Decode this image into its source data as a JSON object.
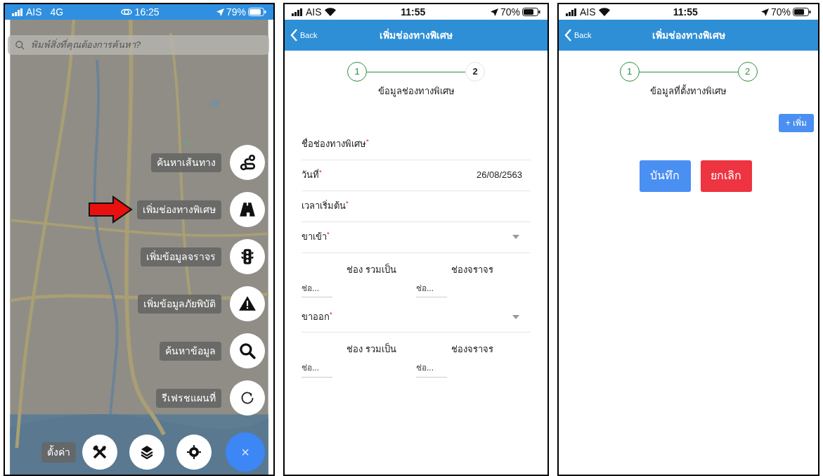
{
  "screens": [
    {
      "kind": "map",
      "status_bar": {
        "carrier": "AIS",
        "network": "4G",
        "wifi": false,
        "time": "16:25",
        "sync": true,
        "battery": "79%"
      },
      "search": {
        "placeholder": "พิมพ์สิ่งที่คุณต้องการค้นหา?"
      },
      "menu": [
        {
          "label": "ค้นหาเส้นทาง",
          "kind": "route",
          "pointed": false
        },
        {
          "label": "เพิ่มช่องทางพิเศษ",
          "kind": "road",
          "pointed": true
        },
        {
          "label": "เพิ่มข้อมูลจราจร",
          "kind": "traffic",
          "pointed": false
        },
        {
          "label": "เพิ่มข้อมูลภัยพิบัติ",
          "kind": "warning",
          "pointed": false
        },
        {
          "label": "ค้นหาข้อมูล",
          "kind": "search",
          "pointed": false
        },
        {
          "label": "รีเฟรชแผนที่",
          "kind": "refresh",
          "pointed": false
        }
      ],
      "bottom": {
        "label": "ตั้งค่า",
        "buttons": [
          {
            "kind": "tools"
          },
          {
            "kind": "layers"
          },
          {
            "kind": "locate"
          }
        ],
        "close": "×"
      }
    },
    {
      "kind": "form",
      "status_bar": {
        "carrier": "AIS",
        "wifi": true,
        "time": "11:55",
        "sync": false,
        "battery": "70%"
      },
      "nav": {
        "back": "Back",
        "title": "เพิ่มช่องทางพิเศษ"
      },
      "steps": [
        {
          "label": "1",
          "done": true
        },
        {
          "label": "2",
          "done": false
        }
      ],
      "step_title": "ข้อมูลช่องทางพิเศษ",
      "fields": [
        {
          "kind": "text",
          "label": "ชื่อช่องทางพิเศษ$^{*}$"
        },
        {
          "kind": "text",
          "label": "วันที่$^{*}$",
          "value": "26/08/2563"
        },
        {
          "kind": "text",
          "label": "เวลาเริ่มต้น$^{*}$"
        },
        {
          "kind": "select",
          "label": "ขาเข้า$^{*}$"
        },
        {
          "kind": "lanes",
          "left_label": "ช่อง รวมเป็น",
          "right_label": "ช่องจราจร",
          "inputs": [
            {
              "placeholder": "ช่อ..."
            },
            {
              "placeholder": "ช่อ..."
            }
          ]
        },
        {
          "kind": "select",
          "label": "ขาออก$^{*}$"
        },
        {
          "kind": "lanes",
          "left_label": "ช่อง รวมเป็น",
          "right_label": "ช่องจราจร",
          "inputs": [
            {
              "placeholder": "ช่อ..."
            },
            {
              "placeholder": "ช่อ..."
            }
          ]
        }
      ]
    },
    {
      "kind": "form",
      "status_bar": {
        "carrier": "AIS",
        "wifi": true,
        "time": "11:55",
        "sync": false,
        "battery": "70%"
      },
      "nav": {
        "back": "Back",
        "title": "เพิ่มช่องทางพิเศษ"
      },
      "steps": [
        {
          "label": "1",
          "done": true
        },
        {
          "label": "2",
          "done": true
        }
      ],
      "step_title": "ข้อมูลที่ตั้งทางพิเศษ",
      "add_button": "+ เพิ่ม",
      "actions": [
        {
          "label": "บันทึก",
          "kind": "save"
        },
        {
          "label": "ยกเลิก",
          "kind": "cancel"
        }
      ]
    }
  ]
}
